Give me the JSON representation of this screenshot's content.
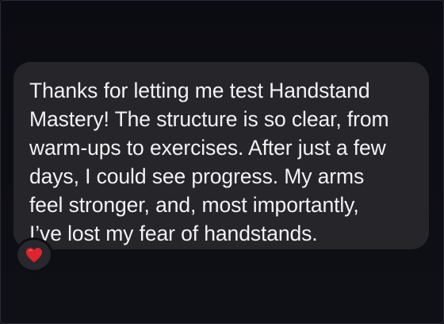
{
  "message": {
    "lines": [
      "Thanks for letting me test Handstand",
      "Mastery! The structure is so clear, from",
      "warm-ups to exercises. After just a few",
      "days, I could see progress. My arms",
      "feel stronger, and, most importantly,",
      "I’ve lost my fear of handstands."
    ],
    "reaction": {
      "icon": "red-heart-icon",
      "color": "#e0232e"
    }
  },
  "colors": {
    "background": "#0d0e14",
    "bubble": "#26262a",
    "text": "#f2f2f4"
  }
}
